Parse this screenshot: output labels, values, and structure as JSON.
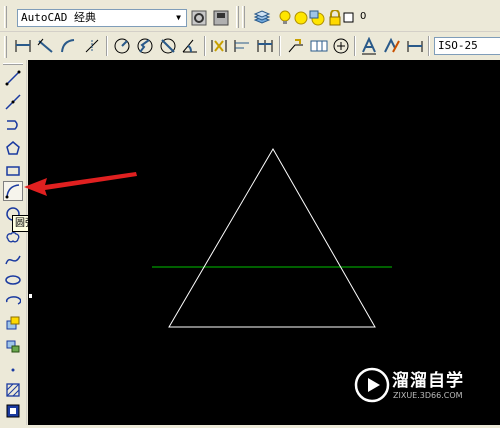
{
  "toolbar": {
    "workspace_value": "AutoCAD 经典",
    "layer_value": "0",
    "dimstyle_value": "ISO-25"
  },
  "left_toolbar": {
    "tooltip": "圆弧"
  },
  "watermark": {
    "title": "溜溜自学",
    "url": "ZIXUE.3D66.COM"
  },
  "colors": {
    "canvas": "#000000",
    "triangle": "#ffffff",
    "green_line": "#00c000",
    "arrow": "#e02020"
  }
}
